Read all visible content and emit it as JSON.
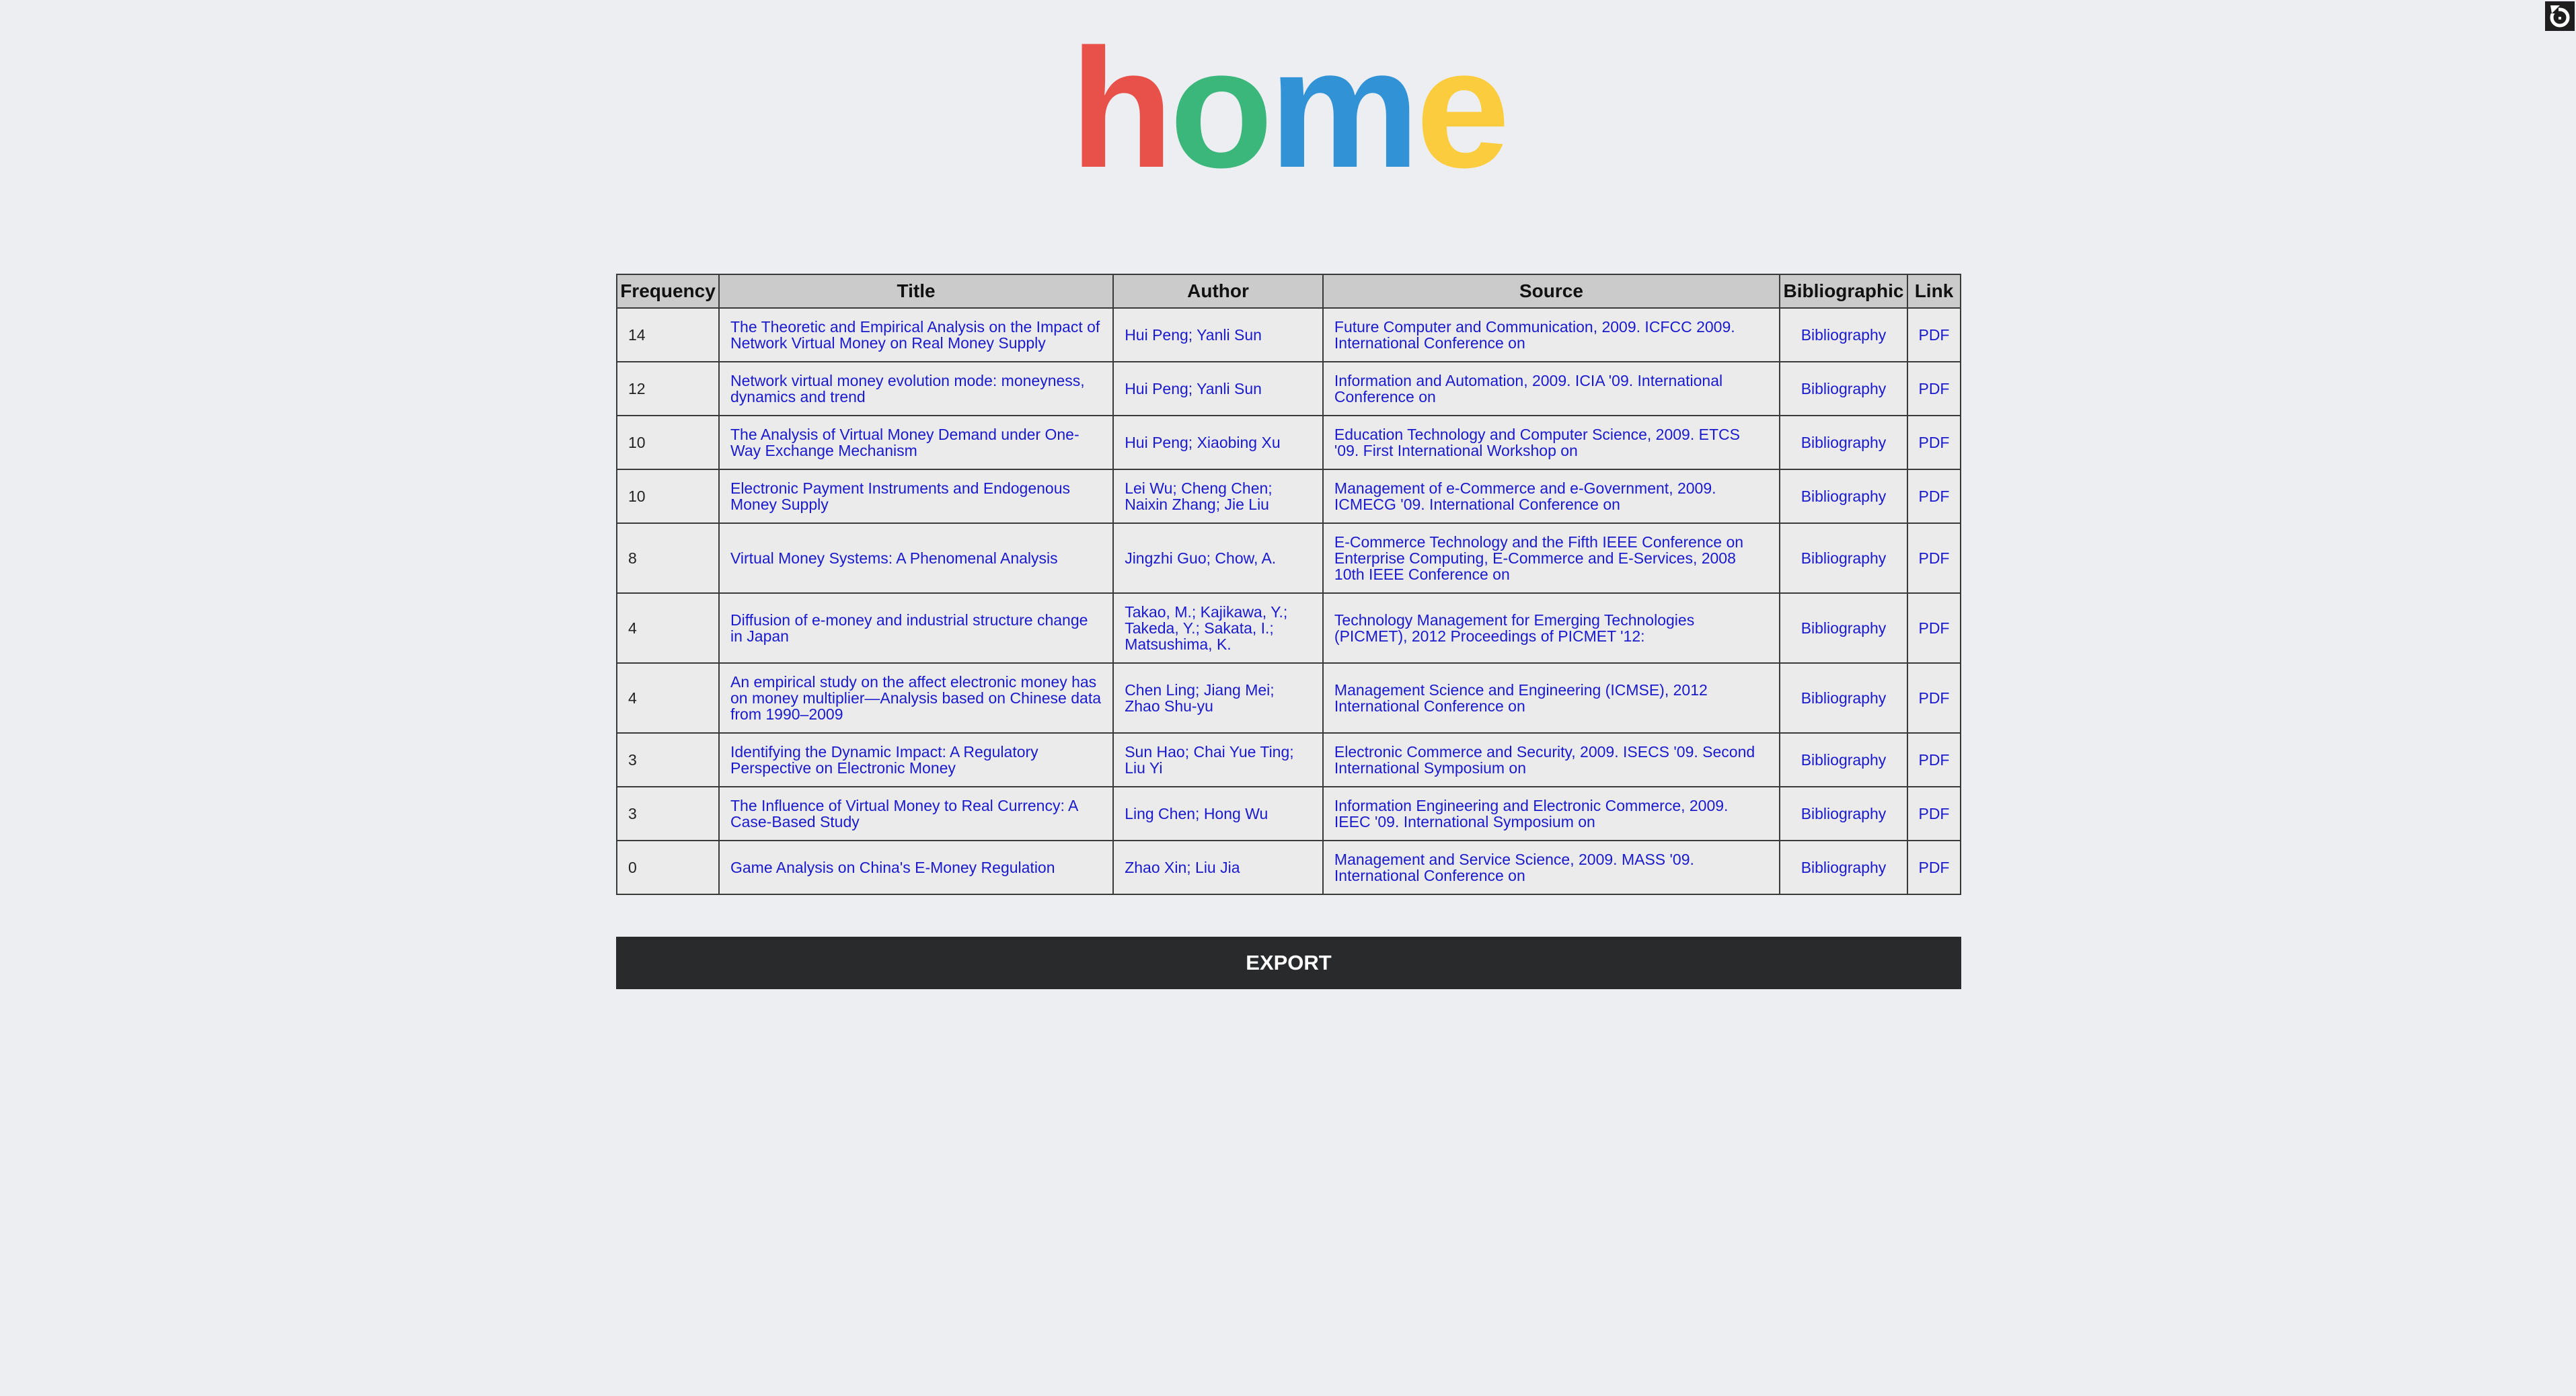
{
  "logo": {
    "letters": [
      "h",
      "o",
      "m",
      "e"
    ],
    "colors": [
      "#e8514a",
      "#3cb77b",
      "#3192d6",
      "#fbcc3d"
    ]
  },
  "table": {
    "headers": {
      "frequency": "Frequency",
      "title": "Title",
      "author": "Author",
      "source": "Source",
      "bibliographic": "Bibliographic",
      "link": "Link"
    },
    "rows": [
      {
        "frequency": "14",
        "title": "The Theoretic and Empirical Analysis on the Impact of Network Virtual Money on Real Money Supply",
        "author": "Hui Peng; Yanli Sun",
        "source": "Future Computer and Communication, 2009. ICFCC 2009. International Conference on",
        "bibliographic": "Bibliography",
        "link": "PDF"
      },
      {
        "frequency": "12",
        "title": "Network virtual money evolution mode: moneyness, dynamics and trend",
        "author": "Hui Peng; Yanli Sun",
        "source": "Information and Automation, 2009. ICIA '09. International Conference on",
        "bibliographic": "Bibliography",
        "link": "PDF"
      },
      {
        "frequency": "10",
        "title": "The Analysis of Virtual Money Demand under One-Way Exchange Mechanism",
        "author": "Hui Peng; Xiaobing Xu",
        "source": "Education Technology and Computer Science, 2009. ETCS '09. First International Workshop on",
        "bibliographic": "Bibliography",
        "link": "PDF"
      },
      {
        "frequency": "10",
        "title": "Electronic Payment Instruments and Endogenous Money Supply",
        "author": "Lei Wu; Cheng Chen; Naixin Zhang; Jie Liu",
        "source": "Management of e-Commerce and e-Government, 2009. ICMECG '09. International Conference on",
        "bibliographic": "Bibliography",
        "link": "PDF"
      },
      {
        "frequency": "8",
        "title": "Virtual Money Systems: A Phenomenal Analysis",
        "author": "Jingzhi Guo; Chow, A.",
        "source": "E-Commerce Technology and the Fifth IEEE Conference on Enterprise Computing, E-Commerce and E-Services, 2008 10th IEEE Conference on",
        "bibliographic": "Bibliography",
        "link": "PDF"
      },
      {
        "frequency": "4",
        "title": "Diffusion of e-money and industrial structure change in Japan",
        "author": "Takao, M.; Kajikawa, Y.; Takeda, Y.; Sakata, I.; Matsushima, K.",
        "source": "Technology Management for Emerging Technologies (PICMET), 2012 Proceedings of PICMET '12:",
        "bibliographic": "Bibliography",
        "link": "PDF"
      },
      {
        "frequency": "4",
        "title": "An empirical study on the affect electronic money has on money multiplier—Analysis based on Chinese data from 1990–2009",
        "author": "Chen Ling; Jiang Mei; Zhao Shu-yu",
        "source": "Management Science and Engineering (ICMSE), 2012 International Conference on",
        "bibliographic": "Bibliography",
        "link": "PDF"
      },
      {
        "frequency": "3",
        "title": "Identifying the Dynamic Impact: A Regulatory Perspective on Electronic Money",
        "author": "Sun Hao; Chai Yue Ting; Liu Yi",
        "source": "Electronic Commerce and Security, 2009. ISECS '09. Second International Symposium on",
        "bibliographic": "Bibliography",
        "link": "PDF"
      },
      {
        "frequency": "3",
        "title": "The Influence of Virtual Money to Real Currency: A Case-Based Study",
        "author": "Ling Chen; Hong Wu",
        "source": "Information Engineering and Electronic Commerce, 2009. IEEC '09. International Symposium on",
        "bibliographic": "Bibliography",
        "link": "PDF"
      },
      {
        "frequency": "0",
        "title": "Game Analysis on China's E-Money Regulation",
        "author": "Zhao Xin; Liu Jia",
        "source": "Management and Service Science, 2009. MASS '09. International Conference on",
        "bibliographic": "Bibliography",
        "link": "PDF"
      }
    ]
  },
  "export_label": "EXPORT",
  "icons": {
    "corner": "reset-icon"
  }
}
